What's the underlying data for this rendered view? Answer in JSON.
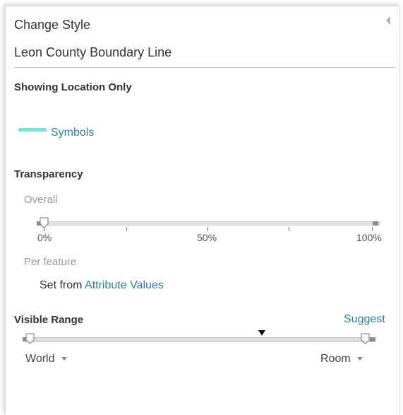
{
  "header": {
    "title": "Change Style",
    "layer_name": "Leon County Boundary Line"
  },
  "location": {
    "heading": "Showing Location Only",
    "symbols_link": "Symbols",
    "symbol_color": "#6fe7d8"
  },
  "transparency": {
    "heading": "Transparency",
    "overall_label": "Overall",
    "overall_value_pct": 0,
    "ticks": [
      "0%",
      "50%",
      "100%"
    ],
    "per_feature_label": "Per feature",
    "set_from_prefix": "Set from",
    "attribute_values_link": "Attribute Values"
  },
  "visible_range": {
    "heading": "Visible Range",
    "suggest_link": "Suggest",
    "min_option": "World",
    "max_option": "Room"
  },
  "colors": {
    "link": "#2b7eb4",
    "heading": "#333333",
    "muted": "#999999"
  }
}
